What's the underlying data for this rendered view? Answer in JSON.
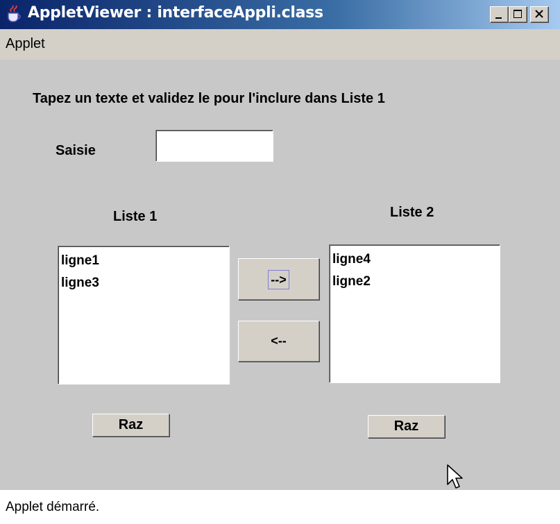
{
  "window": {
    "title": "AppletViewer : interfaceAppli.class",
    "icon": "java-coffee-cup-icon",
    "controls": [
      "minimize-icon",
      "maximize-icon",
      "close-icon"
    ]
  },
  "menubar": {
    "items": [
      {
        "label": "Applet"
      }
    ]
  },
  "form": {
    "instruction": "Tapez un texte et validez le pour l'inclure dans Liste 1",
    "saisie_label": "Saisie",
    "saisie_value": ""
  },
  "liste1": {
    "label": "Liste 1",
    "items": [
      "ligne1",
      "ligne3"
    ]
  },
  "liste2": {
    "label": "Liste 2",
    "items": [
      "ligne4",
      "ligne2"
    ]
  },
  "buttons": {
    "move_right": "-->",
    "move_left": "<--",
    "raz1": "Raz",
    "raz2": "Raz"
  },
  "status": {
    "text": "Applet démarré."
  },
  "colors": {
    "titlebar_start": "#0a246a",
    "titlebar_end": "#a6caf0",
    "content_bg": "#c8c8c8",
    "chrome_bg": "#d4d0c8"
  }
}
